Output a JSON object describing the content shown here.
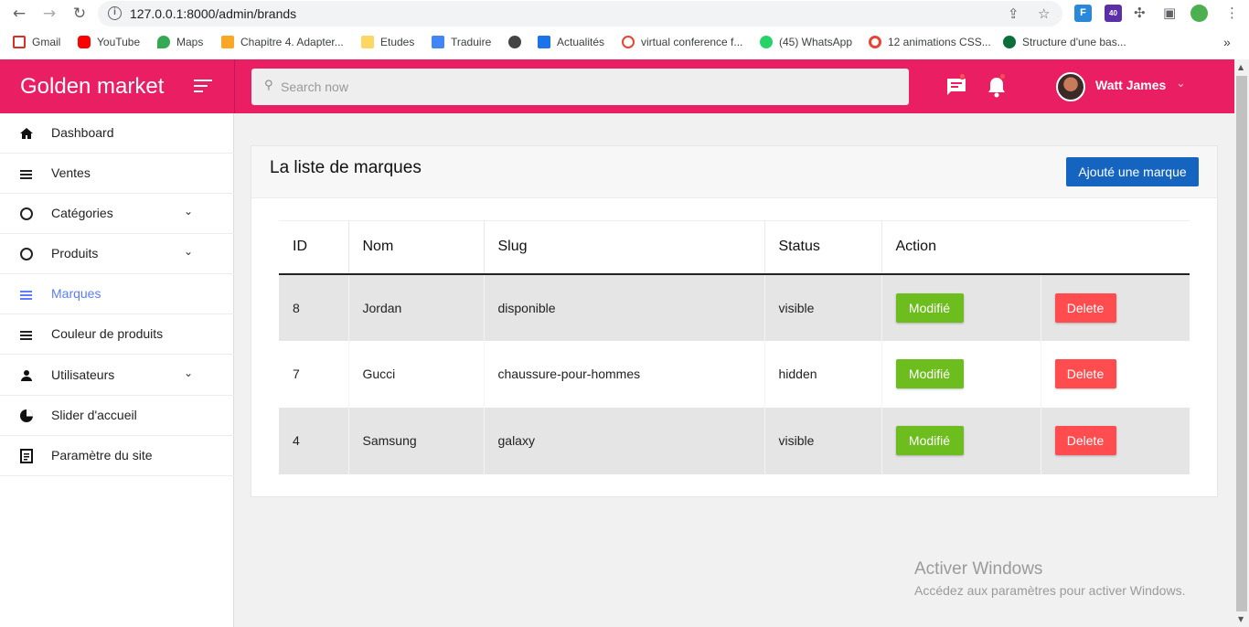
{
  "browser": {
    "url": "127.0.0.1:8000/admin/brands",
    "extension_badge": "40",
    "bookmarks": [
      "Gmail",
      "YouTube",
      "Maps",
      "Chapitre 4. Adapter...",
      "Etudes",
      "Traduire",
      "Actualités",
      "virtual conference f...",
      "(45) WhatsApp",
      "12 animations CSS...",
      "Structure d'une bas..."
    ]
  },
  "app": {
    "brand": "Golden market",
    "search_placeholder": "Search now",
    "user_name": "Watt James"
  },
  "sidebar": {
    "items": [
      {
        "label": "Dashboard"
      },
      {
        "label": "Ventes"
      },
      {
        "label": "Catégories"
      },
      {
        "label": "Produits"
      },
      {
        "label": "Marques"
      },
      {
        "label": "Couleur de produits"
      },
      {
        "label": "Utilisateurs"
      },
      {
        "label": "Slider d'accueil"
      },
      {
        "label": "Paramètre du site"
      }
    ]
  },
  "main": {
    "title": "La liste de marques",
    "add_button": "Ajouté une marque",
    "table": {
      "headers": [
        "ID",
        "Nom",
        "Slug",
        "Status",
        "Action"
      ],
      "rows": [
        {
          "id": "8",
          "name": "Jordan",
          "slug": "disponible",
          "status": "visible"
        },
        {
          "id": "7",
          "name": "Gucci",
          "slug": "chaussure-pour-hommes",
          "status": "hidden"
        },
        {
          "id": "4",
          "name": "Samsung",
          "slug": "galaxy",
          "status": "visible"
        }
      ],
      "edit_label": "Modifié",
      "delete_label": "Delete"
    }
  },
  "watermark": {
    "line1": "Activer Windows",
    "line2": "Accédez aux paramètres pour activer Windows."
  },
  "colors": {
    "primary": "#e91e63",
    "accent_blue": "#1565c0",
    "edit_green": "#6cbd1d",
    "delete_red": "#ff4d4f",
    "active_menu": "#5c7cfa"
  }
}
